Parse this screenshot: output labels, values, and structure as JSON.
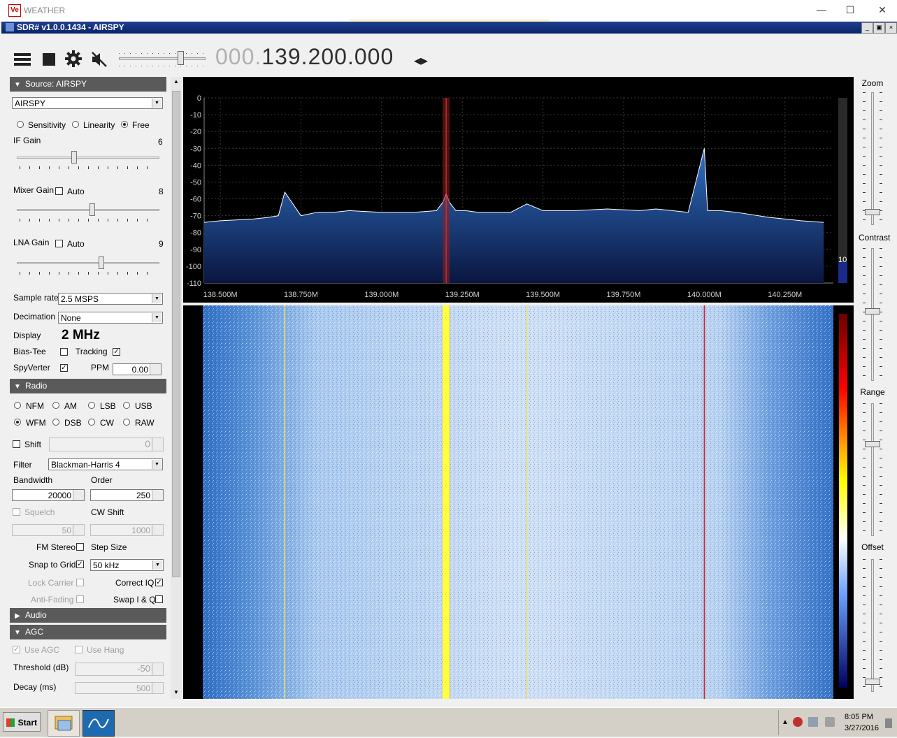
{
  "outer_window": {
    "title": "WEATHER",
    "logo": "Ve"
  },
  "inner_window": {
    "title": "SDR# v1.0.0.1434 - AIRSPY"
  },
  "toolbar": {
    "menu_icon": "hamburger-icon",
    "stop_icon": "stop-icon",
    "settings_icon": "gear-icon",
    "mute_icon": "speaker-muted-icon",
    "volume_level": 0.7,
    "frequency_dim": "000.",
    "frequency_main": "139.200.000",
    "tuning_arrows": "◂▸"
  },
  "source": {
    "header": "Source: AIRSPY",
    "device": "AIRSPY",
    "modes": [
      {
        "label": "Sensitivity",
        "selected": false
      },
      {
        "label": "Linearity",
        "selected": false
      },
      {
        "label": "Free",
        "selected": true
      }
    ],
    "if_gain": {
      "label": "IF Gain",
      "value": "6"
    },
    "mixer_gain": {
      "label": "Mixer Gain",
      "auto_label": "Auto",
      "value": "8"
    },
    "lna_gain": {
      "label": "LNA Gain",
      "auto_label": "Auto",
      "value": "9"
    },
    "sample_rate": {
      "label": "Sample rate",
      "value": "2.5 MSPS"
    },
    "decimation": {
      "label": "Decimation",
      "value": "None"
    },
    "display": {
      "label": "Display",
      "value": "2 MHz"
    },
    "bias_tee": {
      "label": "Bias-Tee"
    },
    "tracking": {
      "label": "Tracking"
    },
    "spyverter": {
      "label": "SpyVerter"
    },
    "ppm": {
      "label": "PPM",
      "value": "0.00"
    }
  },
  "radio": {
    "header": "Radio",
    "modes_row1": [
      "NFM",
      "AM",
      "LSB",
      "USB"
    ],
    "modes_row2": [
      "WFM",
      "DSB",
      "CW",
      "RAW"
    ],
    "selected_mode": "WFM",
    "shift": {
      "label": "Shift",
      "value": "0"
    },
    "filter": {
      "label": "Filter",
      "value": "Blackman-Harris 4"
    },
    "bandwidth": {
      "label": "Bandwidth",
      "value": "20000"
    },
    "order": {
      "label": "Order",
      "value": "250"
    },
    "squelch": {
      "label": "Squelch",
      "value": "50"
    },
    "cw_shift": {
      "label": "CW Shift",
      "value": "1000"
    },
    "fm_stereo": {
      "label": "FM Stereo"
    },
    "step_size": {
      "label": "Step Size",
      "value": "50 kHz"
    },
    "snap_to_grid": {
      "label": "Snap to Grid"
    },
    "lock_carrier": {
      "label": "Lock Carrier"
    },
    "correct_iq": {
      "label": "Correct IQ"
    },
    "anti_fading": {
      "label": "Anti-Fading"
    },
    "swap_iq": {
      "label": "Swap I & Q"
    }
  },
  "audio": {
    "header": "Audio"
  },
  "agc": {
    "header": "AGC",
    "use_agc": "Use AGC",
    "use_hang": "Use Hang",
    "threshold": {
      "label": "Threshold (dB)",
      "value": "-50"
    },
    "decay": {
      "label": "Decay (ms)",
      "value": "500"
    }
  },
  "right_panel": {
    "zoom": "Zoom",
    "contrast": "Contrast",
    "range": "Range",
    "offset": "Offset",
    "level_readout": "10"
  },
  "spectrum": {
    "y_ticks": [
      "0",
      "-10",
      "-20",
      "-30",
      "-40",
      "-50",
      "-60",
      "-70",
      "-80",
      "-90",
      "-100",
      "-110"
    ],
    "x_ticks": [
      "138.500M",
      "138.750M",
      "139.000M",
      "139.250M",
      "139.500M",
      "139.750M",
      "140.000M",
      "140.250M"
    ]
  },
  "chart_data": {
    "type": "line",
    "title": "",
    "xlabel": "",
    "ylabel": "",
    "xlim_mhz": [
      138.45,
      140.4
    ],
    "ylim": [
      -110,
      0
    ],
    "x_mhz": [
      138.45,
      138.5,
      138.6,
      138.65,
      138.68,
      138.7,
      138.75,
      138.8,
      138.85,
      138.9,
      139.0,
      139.1,
      139.17,
      139.19,
      139.2,
      139.21,
      139.23,
      139.26,
      139.3,
      139.4,
      139.45,
      139.5,
      139.6,
      139.7,
      139.8,
      139.85,
      139.9,
      139.95,
      140.0,
      140.01,
      140.05,
      140.1,
      140.2,
      140.3,
      140.37
    ],
    "y_db": [
      -74,
      -73,
      -72,
      -71,
      -70,
      -56,
      -70,
      -68,
      -68,
      -67,
      -68,
      -68,
      -67,
      -62,
      -57,
      -62,
      -67,
      -67,
      -68,
      -68,
      -63,
      -67,
      -67,
      -66,
      -67,
      -66,
      -67,
      -68,
      -30,
      -67,
      -67,
      -68,
      -71,
      -73,
      -74
    ],
    "tuned_frequency_mhz": 139.2
  },
  "taskbar": {
    "start_label": "Start",
    "time": "8:05 PM",
    "date": "3/27/2016"
  }
}
